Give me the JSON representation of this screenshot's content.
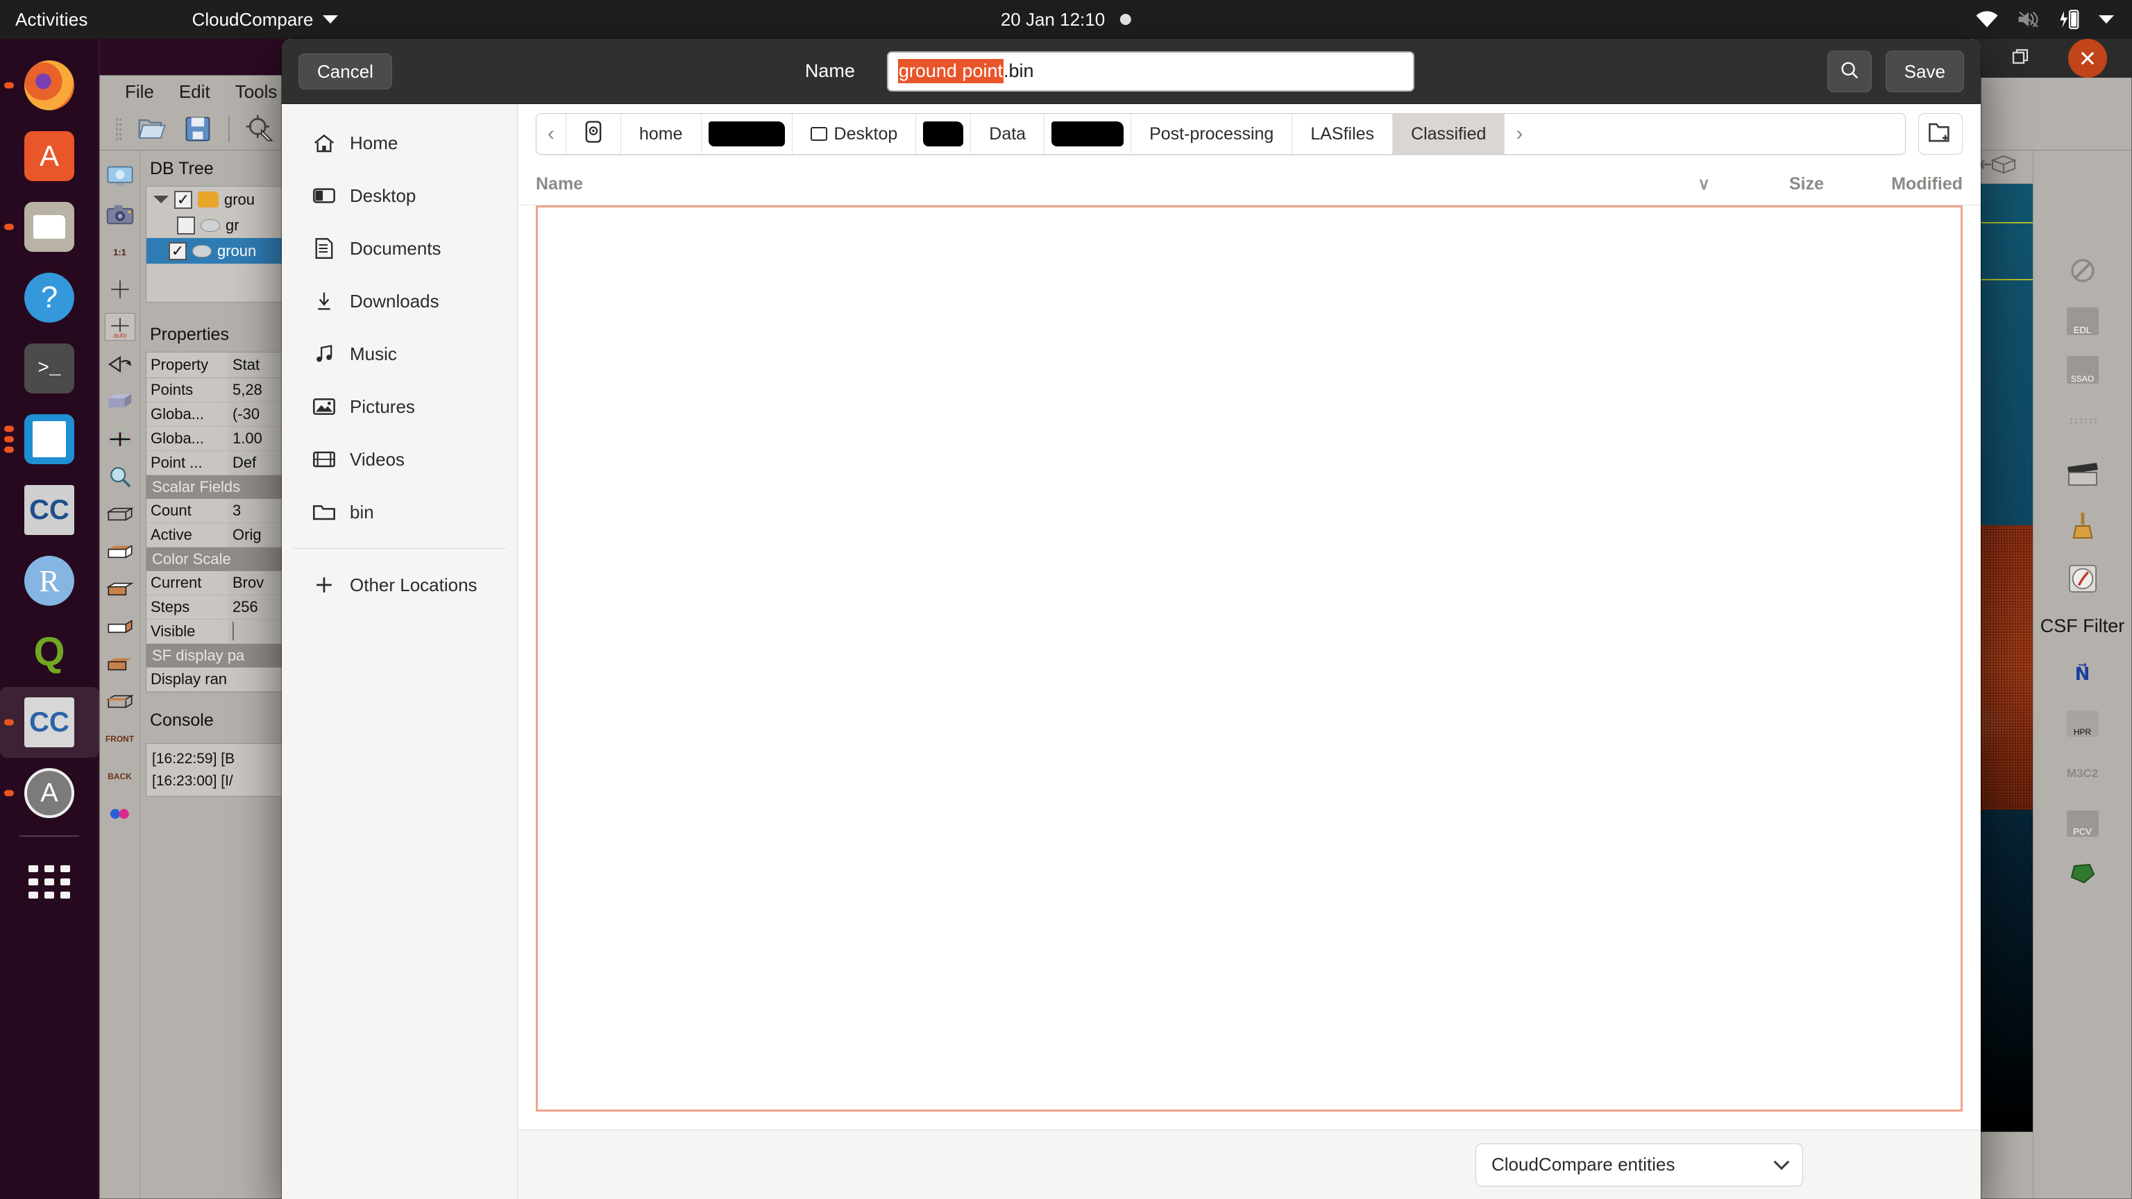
{
  "topbar": {
    "activities": "Activities",
    "app_name": "CloudCompare",
    "clock": "20 Jan  12:10",
    "icons": [
      "wifi-icon",
      "volume-muted-icon",
      "battery-charging-icon",
      "system-menu-chevron-icon"
    ]
  },
  "window_controls": {
    "minimize": "minimize-button",
    "restore": "restore-button",
    "close": "close-button"
  },
  "dock": {
    "items": [
      {
        "name": "firefox",
        "running": true
      },
      {
        "name": "ubuntu-software",
        "running": false
      },
      {
        "name": "files-nautilus",
        "running": true
      },
      {
        "name": "help",
        "running": false
      },
      {
        "name": "terminal",
        "running": false
      },
      {
        "name": "libreoffice",
        "running": true
      },
      {
        "name": "cloudcompare-viewer",
        "running": false
      },
      {
        "name": "rstudio",
        "running": false
      },
      {
        "name": "qgis",
        "running": false
      },
      {
        "name": "cloudcompare",
        "running": true
      },
      {
        "name": "ubuntu-software-alt",
        "running": true
      }
    ],
    "show_apps_label": "show-applications"
  },
  "cloudcompare": {
    "menu": [
      "File",
      "Edit",
      "Tools"
    ],
    "db_tree": {
      "title": "DB Tree",
      "rows": [
        {
          "label": "grou",
          "checked": true,
          "icon": "folder-icon",
          "selected": false,
          "indent": 0
        },
        {
          "label": "gr",
          "checked": false,
          "icon": "cloud-icon",
          "selected": false,
          "indent": 1
        },
        {
          "label": "groun",
          "checked": true,
          "icon": "cloud-icon",
          "selected": true,
          "indent": 1
        }
      ]
    },
    "properties": {
      "title": "Properties",
      "headers": [
        "Property",
        "Stat"
      ],
      "rows": [
        {
          "type": "kv",
          "key": "Points",
          "value": "5,28"
        },
        {
          "type": "kv",
          "key": "Globa...",
          "value": "(-30"
        },
        {
          "type": "kv",
          "key": "Globa...",
          "value": "1.00"
        },
        {
          "type": "kv",
          "key": "Point ...",
          "value": "Def"
        },
        {
          "type": "section",
          "key": "Scalar Fields"
        },
        {
          "type": "kv",
          "key": "Count",
          "value": "3"
        },
        {
          "type": "kv",
          "key": "Active",
          "value": "Orig"
        },
        {
          "type": "section",
          "key": "Color Scale"
        },
        {
          "type": "kv",
          "key": "Current",
          "value": "Brov"
        },
        {
          "type": "kv",
          "key": "Steps",
          "value": "256"
        },
        {
          "type": "checkbox",
          "key": "Visible",
          "value": ""
        },
        {
          "type": "section",
          "key": "SF display pa"
        },
        {
          "type": "kv",
          "key": "  Display ran",
          "value": ""
        }
      ]
    },
    "console": {
      "title": "Console",
      "lines": [
        "[16:22:59] [B",
        "[16:23:00] [I/"
      ]
    },
    "left_tools": [
      "display-icon",
      "camera-icon",
      "1:1",
      "crosshair-icon",
      "auto-crosshair-icon",
      "rotate-icon",
      "box-icon",
      "move-icon",
      "zoom-icon",
      "view-iso1-icon",
      "view-top-icon",
      "view-bottom-icon",
      "view-left-icon",
      "view-right-icon",
      "view-iso2-icon",
      "FRONT",
      "BACK"
    ],
    "right_tools": {
      "label": "CSF Filter",
      "items": [
        "no-filter-icon",
        "EDL",
        "SSAO",
        "grip-icon",
        "animation-icon",
        "broom-icon",
        "compass-icon",
        "csf-filter-label",
        "normals-icon",
        "HPR",
        "M3C2",
        "PCV",
        "polygon-icon"
      ]
    }
  },
  "dialog": {
    "cancel_label": "Cancel",
    "save_label": "Save",
    "search_icon": "search-icon",
    "name_label": "Name",
    "filename_selected": "ground point",
    "filename_rest": ".bin",
    "places": [
      {
        "label": "Home",
        "icon": "home-icon"
      },
      {
        "label": "Desktop",
        "icon": "desktop-icon"
      },
      {
        "label": "Documents",
        "icon": "documents-icon"
      },
      {
        "label": "Downloads",
        "icon": "downloads-icon"
      },
      {
        "label": "Music",
        "icon": "music-icon"
      },
      {
        "label": "Pictures",
        "icon": "pictures-icon"
      },
      {
        "label": "Videos",
        "icon": "videos-icon"
      },
      {
        "label": "bin",
        "icon": "folder-icon"
      },
      {
        "label": "Other Locations",
        "icon": "plus-icon"
      }
    ],
    "breadcrumbs": [
      {
        "label": "",
        "type": "back-arrow"
      },
      {
        "label": "",
        "type": "device-icon"
      },
      {
        "label": "home",
        "type": "text"
      },
      {
        "label": "",
        "type": "redacted",
        "width": 110
      },
      {
        "label": "Desktop",
        "type": "text-with-icon"
      },
      {
        "label": "",
        "type": "redacted",
        "width": 58
      },
      {
        "label": "Data",
        "type": "text"
      },
      {
        "label": "",
        "type": "redacted",
        "width": 104
      },
      {
        "label": "Post-processing",
        "type": "text"
      },
      {
        "label": "LASfiles",
        "type": "text"
      },
      {
        "label": "Classified",
        "type": "current"
      },
      {
        "label": "",
        "type": "forward-arrow"
      }
    ],
    "new_folder_icon": "new-folder-icon",
    "columns": {
      "name": "Name",
      "sort_indicator": "chevron-down-icon",
      "size": "Size",
      "modified": "Modified"
    },
    "file_rows": [],
    "filetype": {
      "value": "CloudCompare entities",
      "chevron": "chevron-down-icon"
    }
  }
}
